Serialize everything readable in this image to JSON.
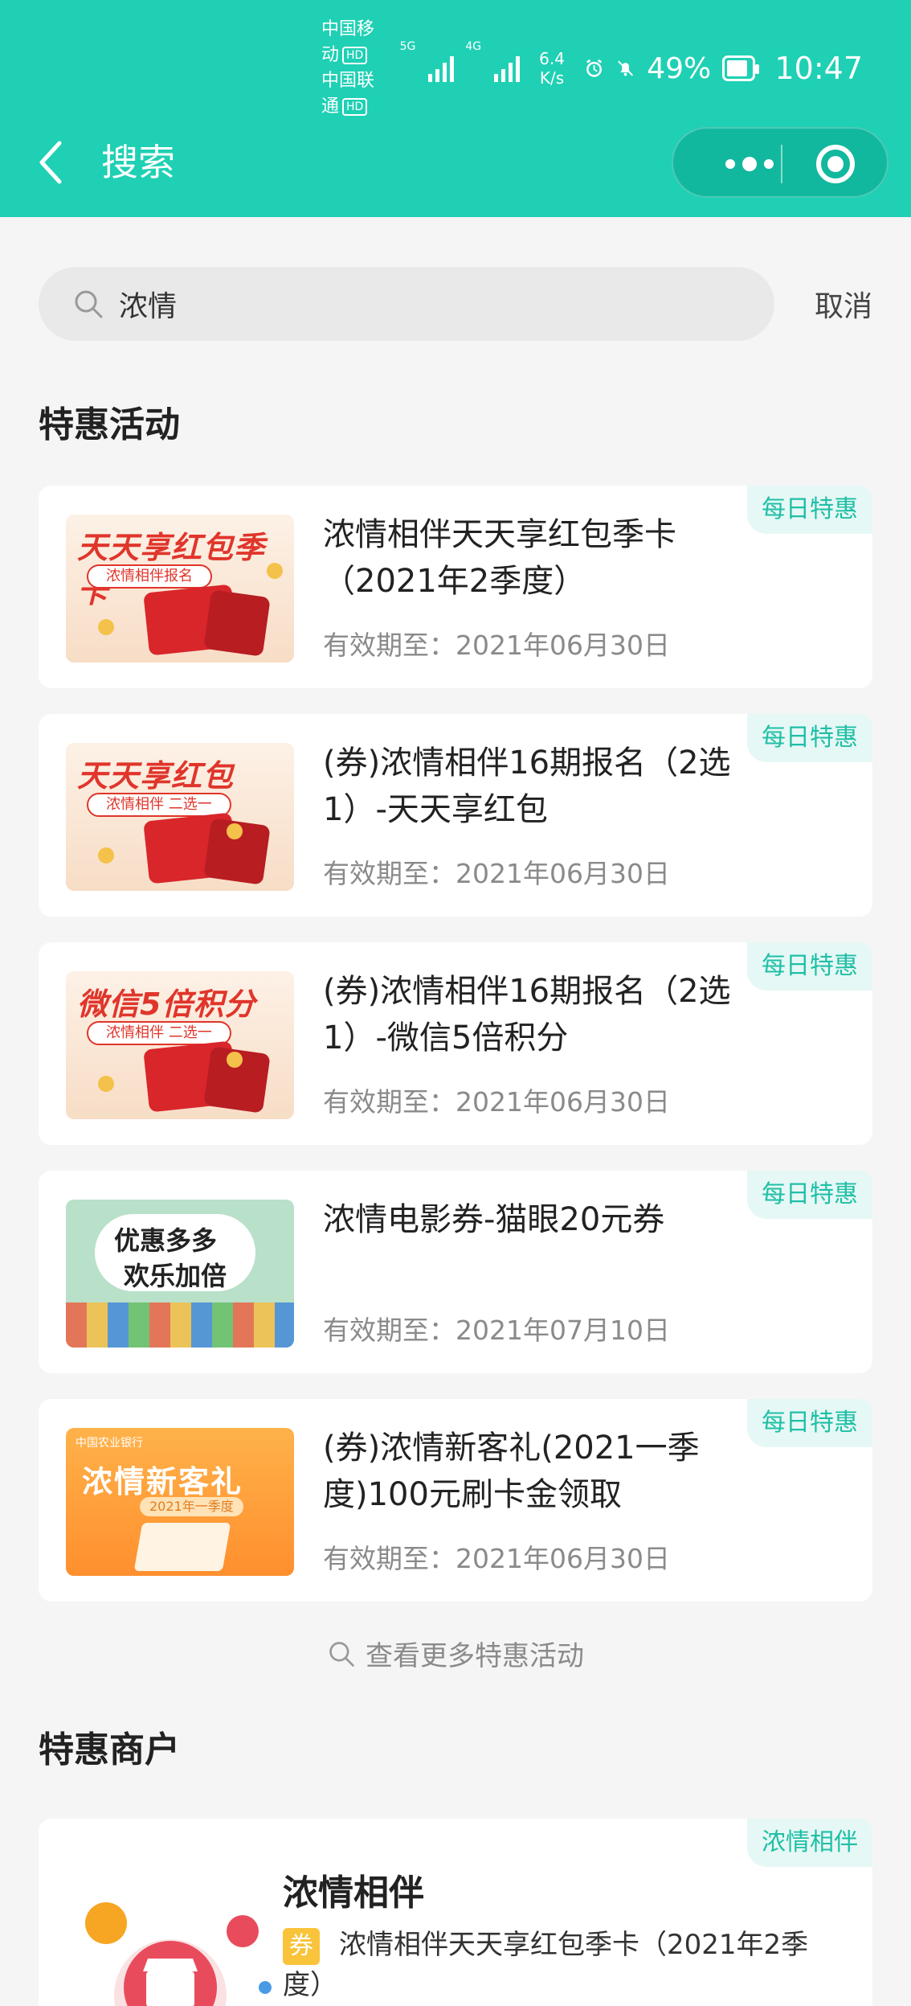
{
  "status_bar": {
    "carrier_1": "中国移动",
    "carrier_2": "中国联通",
    "hd": "HD",
    "net_1": "5G",
    "net_2": "4G",
    "speed_value": "6.4",
    "speed_unit": "K/s",
    "battery": "49%",
    "battery_level": 0.49,
    "time": "10:47"
  },
  "header": {
    "title": "搜索"
  },
  "search": {
    "value": "浓情",
    "cancel": "取消"
  },
  "promotions": {
    "section_title": "特惠活动",
    "items": [
      {
        "title": "浓情相伴天天享红包季卡（2021年2季度）",
        "date": "有效期至：2021年06月30日",
        "tag": "每日特惠",
        "thumb_heading": "天天享红包季卡",
        "thumb_sub": "浓情相伴报名"
      },
      {
        "title": "(券)浓情相伴16期报名（2选1）-天天享红包",
        "date": "有效期至：2021年06月30日",
        "tag": "每日特惠",
        "thumb_heading": "天天享红包",
        "thumb_sub": "浓情相伴 二选一"
      },
      {
        "title": "(券)浓情相伴16期报名（2选1）-微信5倍积分",
        "date": "有效期至：2021年06月30日",
        "tag": "每日特惠",
        "thumb_heading": "微信5倍积分",
        "thumb_sub": "浓情相伴 二选一"
      },
      {
        "title": "浓情电影券-猫眼20元券",
        "date": "有效期至：2021年07月10日",
        "tag": "每日特惠",
        "thumb_line1": "优惠多多",
        "thumb_line2": "欢乐加倍"
      },
      {
        "title": "(券)浓情新客礼(2021一季度)100元刷卡金领取",
        "date": "有效期至：2021年06月30日",
        "tag": "每日特惠",
        "thumb_bank": "中国农业银行",
        "thumb_heading": "浓情新客礼",
        "thumb_sub": "2021年一季度"
      }
    ],
    "more": "查看更多特惠活动"
  },
  "merchants": {
    "section_title": "特惠商户",
    "items": [
      {
        "name": "浓情相伴",
        "tag": "浓情相伴",
        "coupon_badge": "券",
        "coupon_text": "浓情相伴天天享红包季卡（2021年2季度）"
      }
    ]
  },
  "colors": {
    "brand": "#1fd0b4",
    "tag_text": "#1fbfa6",
    "tag_bg": "#e6f8f5",
    "coupon_badge": "#f9c33b"
  },
  "icons": [
    "back-icon",
    "more-dots-icon",
    "close-target-icon",
    "search-icon",
    "alarm-icon",
    "mute-icon",
    "battery-icon"
  ]
}
